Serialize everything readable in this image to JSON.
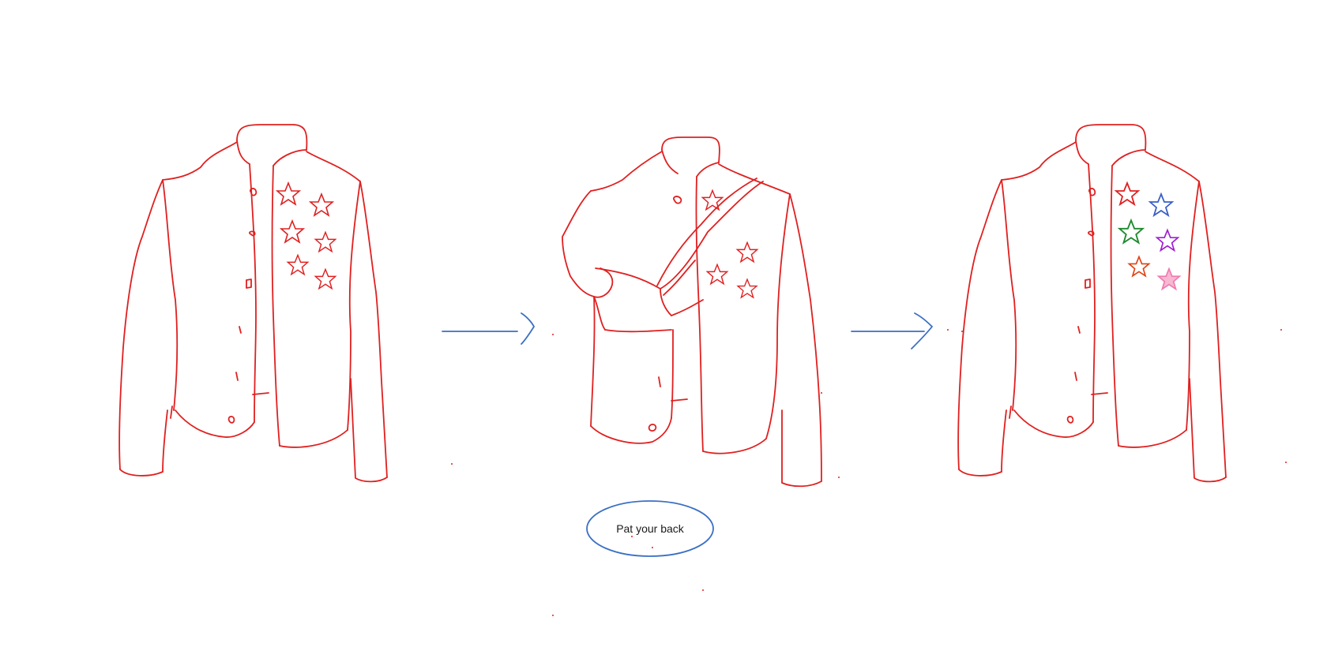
{
  "diagram": {
    "caption": "Pat your back",
    "colors": {
      "jacket_stroke": "#e02020",
      "arrow_stroke": "#3a6fc4",
      "caption_ellipse": "#3a6fc4",
      "caption_text": "#1a1a1a"
    },
    "stages": [
      {
        "name": "jacket-plain-stars",
        "star_colors": [
          "#e02020",
          "#e02020",
          "#e02020",
          "#e02020",
          "#e02020",
          "#e02020"
        ]
      },
      {
        "name": "jacket-arm-patting",
        "star_colors": [
          "#e02020",
          "#e02020",
          "#e02020"
        ]
      },
      {
        "name": "jacket-colored-stars",
        "star_colors": [
          "#e02020",
          "#3a5fc8",
          "#1f8a2e",
          "#a020d0",
          "#e04010",
          "#f07ab0"
        ]
      }
    ]
  }
}
